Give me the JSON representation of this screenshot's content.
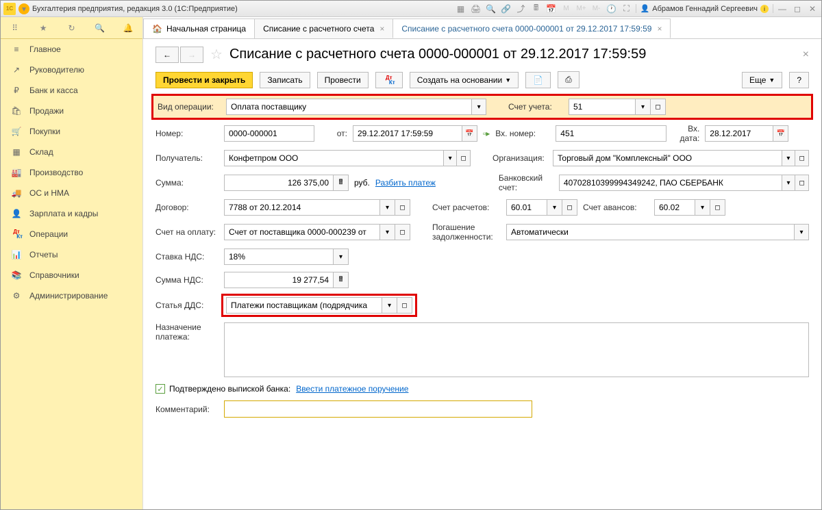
{
  "titlebar": {
    "app_icon": "1C",
    "title": "Бухгалтерия предприятия, редакция 3.0  (1С:Предприятие)",
    "user": "Абрамов Геннадий Сергеевич",
    "m_icons": [
      "M",
      "M+",
      "M-"
    ]
  },
  "sidebar": {
    "items": [
      {
        "icon": "≡",
        "label": "Главное"
      },
      {
        "icon": "↗",
        "label": "Руководителю"
      },
      {
        "icon": "₽",
        "label": "Банк и касса"
      },
      {
        "icon": "🛍",
        "label": "Продажи"
      },
      {
        "icon": "🛒",
        "label": "Покупки"
      },
      {
        "icon": "▦",
        "label": "Склад"
      },
      {
        "icon": "🏭",
        "label": "Производство"
      },
      {
        "icon": "🚚",
        "label": "ОС и НМА"
      },
      {
        "icon": "👤",
        "label": "Зарплата и кадры"
      },
      {
        "icon": "ДК",
        "label": "Операции"
      },
      {
        "icon": "📊",
        "label": "Отчеты"
      },
      {
        "icon": "📚",
        "label": "Справочники"
      },
      {
        "icon": "⚙",
        "label": "Администрирование"
      }
    ]
  },
  "tabs": {
    "home": "Начальная страница",
    "open": [
      "Списание с расчетного счета",
      "Списание с расчетного счета 0000-000001 от 29.12.2017 17:59:59"
    ]
  },
  "page": {
    "title": "Списание с расчетного счета 0000-000001 от 29.12.2017 17:59:59"
  },
  "toolbar": {
    "save_close": "Провести и закрыть",
    "write": "Записать",
    "post": "Провести",
    "create_based": "Создать на основании",
    "more": "Еще",
    "help": "?"
  },
  "labels": {
    "op_type": "Вид операции:",
    "account": "Счет учета:",
    "number": "Номер:",
    "from": "от:",
    "inc_number": "Вх. номер:",
    "inc_date": "Вх. дата:",
    "recipient": "Получатель:",
    "organization": "Организация:",
    "sum": "Сумма:",
    "rub": "руб.",
    "split": "Разбить платеж",
    "bank_account": "Банковский счет:",
    "contract": "Договор:",
    "settlement": "Счет расчетов:",
    "advance": "Счет авансов:",
    "invoice": "Счет на оплату:",
    "debt": "Погашение задолженности:",
    "vat_rate": "Ставка НДС:",
    "vat_sum": "Сумма НДС:",
    "dds": "Статья ДДС:",
    "purpose": "Назначение платежа:",
    "confirmed": "Подтверждено выпиской банка:",
    "enter_order": "Ввести платежное поручение",
    "comment": "Комментарий:"
  },
  "values": {
    "op_type": "Оплата поставщику",
    "account": "51",
    "number": "0000-000001",
    "date": "29.12.2017 17:59:59",
    "inc_number": "451",
    "inc_date": "28.12.2017",
    "recipient": "Конфетпром ООО",
    "organization": "Торговый дом \"Комплексный\" ООО",
    "sum": "126 375,00",
    "bank_account": "40702810399994349242, ПАО СБЕРБАНК",
    "contract": "7788 от 20.12.2014",
    "settlement": "60.01",
    "advance": "60.02",
    "invoice": "Счет от поставщика 0000-000239 от",
    "debt": "Автоматически",
    "vat_rate": "18%",
    "vat_sum": "19 277,54",
    "dds": "Платежи поставщикам (подрядчика",
    "comment": ""
  }
}
